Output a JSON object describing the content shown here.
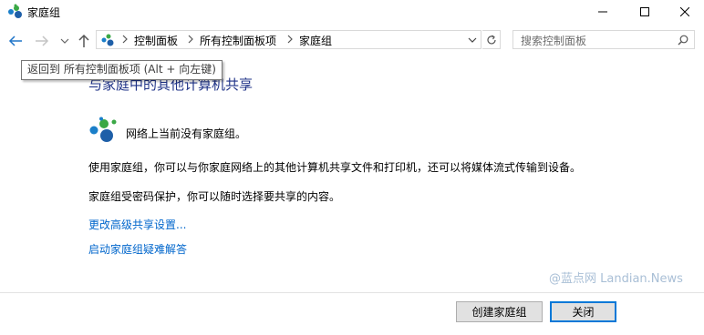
{
  "window": {
    "title": "家庭组"
  },
  "address_bar": {
    "breadcrumbs": [
      "控制面板",
      "所有控制面板项",
      "家庭组"
    ]
  },
  "search": {
    "placeholder": "搜索控制面板"
  },
  "tooltip": {
    "text": "返回到 所有控制面板项 (Alt + 向左键)"
  },
  "main": {
    "heading": "与家庭中的其他计算机共享",
    "status": "网络上当前没有家庭组。",
    "paragraph1": "使用家庭组，你可以与你家庭网络上的其他计算机共享文件和打印机，还可以将媒体流式传输到设备。",
    "paragraph2": "家庭组受密码保护，你可以随时选择要共享的内容。",
    "links": [
      "更改高级共享设置...",
      "启动家庭组疑难解答"
    ]
  },
  "watermark": "@蓝点网 Landian.News",
  "buttons": {
    "create": "创建家庭组",
    "close": "关闭"
  },
  "colors": {
    "link": "#0066cc",
    "heading": "#1e3287",
    "primary_border": "#0078d7"
  }
}
